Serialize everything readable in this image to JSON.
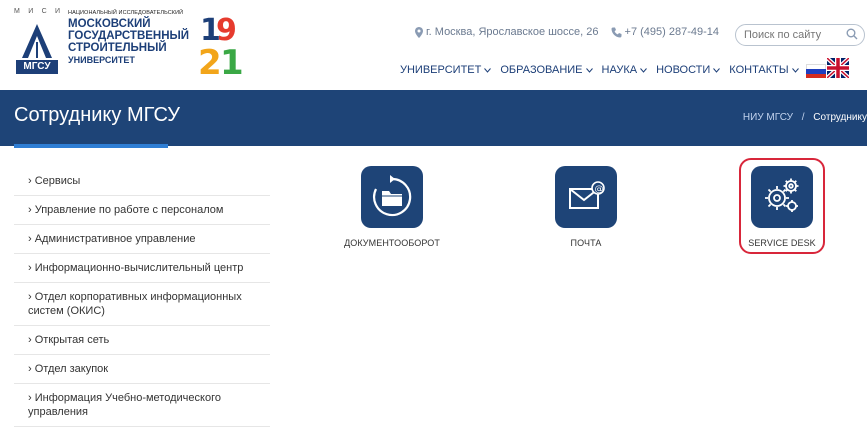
{
  "header": {
    "logo": {
      "letters": [
        "М",
        "И",
        "С",
        "И"
      ],
      "abbr": "МГСУ",
      "small_caption": "НАЦИОНАЛЬНЫЙ ИССЛЕДОВАТЕЛЬСКИЙ",
      "name_lines": [
        "МОСКОВСКИЙ",
        "ГОСУДАРСТВЕННЫЙ",
        "СТРОИТЕЛЬНЫЙ",
        "УНИВЕРСИТЕТ"
      ],
      "year_digits": [
        "1",
        "9",
        "2",
        "1"
      ],
      "year_colors": [
        "#1d3f78",
        "#e63b2e",
        "#f2a51a",
        "#3aa845"
      ]
    },
    "address": "г. Москва, Ярославское шоссе, 26",
    "phone": "+7 (495) 287-49-14",
    "search": {
      "placeholder": "Поиск по сайту"
    },
    "nav": [
      "УНИВЕРСИТЕТ",
      "ОБРАЗОВАНИЕ",
      "НАУКА",
      "НОВОСТИ",
      "КОНТАКТЫ"
    ],
    "icons": {
      "address": "map-pin-icon",
      "phone": "phone-icon",
      "search": "search-icon",
      "dropdown": "chevron-down-icon"
    }
  },
  "banner": {
    "title": "Сотруднику МГСУ",
    "breadcrumb": {
      "home": "НИУ МГСУ",
      "separator": "/",
      "current": "Сотруднику"
    }
  },
  "sidebar": {
    "items": [
      "› Сервисы",
      "› Управление по работе с персоналом",
      "› Административное управление",
      "› Информационно-вычислительный центр",
      "› Отдел корпоративных информационных систем (ОКИС)",
      "› Открытая сеть",
      "› Отдел закупок",
      "› Информация Учебно-методического управления"
    ]
  },
  "tiles": [
    {
      "label": "ДОКУМЕНТООБОРОТ",
      "icon": "folder-refresh-icon"
    },
    {
      "label": "ПОЧТА",
      "icon": "mail-icon"
    },
    {
      "label": "SERVICE DESK",
      "icon": "gears-icon",
      "highlighted": true
    }
  ],
  "colors": {
    "brand_blue": "#1e4477",
    "accent_blue": "#2f7ed4",
    "highlight_red": "#d8263a"
  }
}
